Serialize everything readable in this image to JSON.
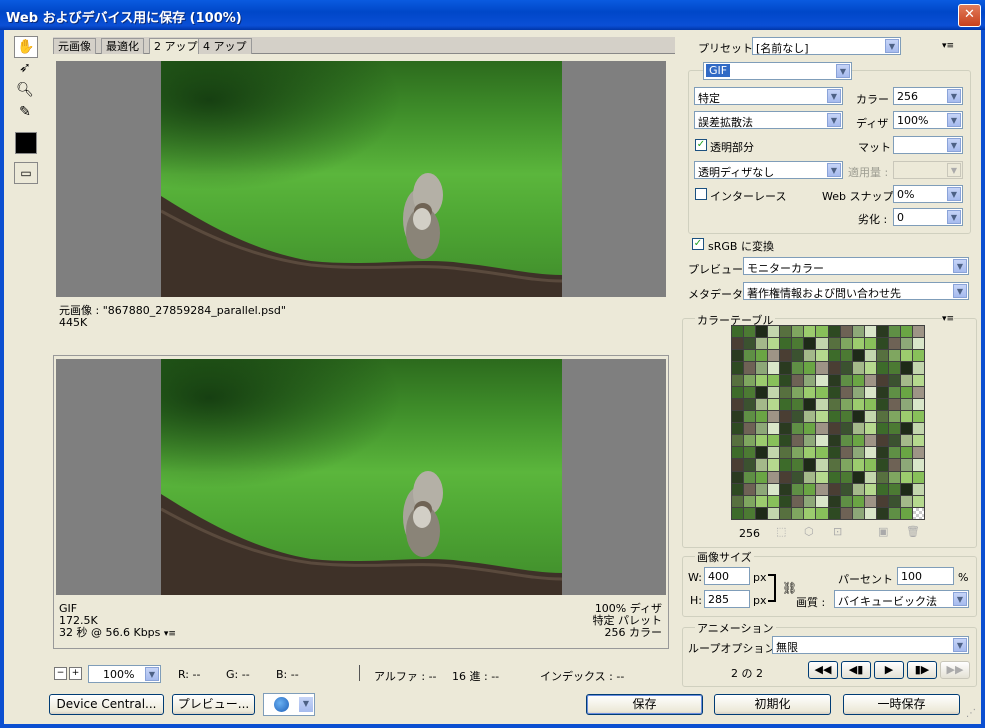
{
  "window": {
    "title": "Web およびデバイス用に保存 (100%)",
    "close": "✕"
  },
  "tabs": [
    {
      "label": "元画像",
      "active": false
    },
    {
      "label": "最適化",
      "active": false
    },
    {
      "label": "2 アップ",
      "active": true
    },
    {
      "label": "4 アップ",
      "active": false
    }
  ],
  "original_info": {
    "line1": "元画像 : \"867880_27859284_parallel.psd\"",
    "line2": "445K"
  },
  "optimized_info": {
    "format": "GIF",
    "size": "172.5K",
    "time": "32 秒 @ 56.6 Kbps",
    "dither": "100% ディザ",
    "palette": "特定 パレット",
    "colors": "256 カラー"
  },
  "bottom_bar": {
    "zoom": "100%",
    "r": "R: --",
    "g": "G: --",
    "b": "B: --",
    "alpha": "アルファ : --",
    "hex": "16 進 : --",
    "index": "インデックス : --"
  },
  "buttons": {
    "device_central": "Device Central...",
    "preview": "プレビュー...",
    "save": "保存",
    "reset": "初期化",
    "remember": "一時保存"
  },
  "settings": {
    "preset_label": "プリセット :",
    "preset_value": "[名前なし]",
    "format_value": "GIF",
    "reduction_value": "特定",
    "dither_algo_value": "誤差拡散法",
    "colors_label": "カラー :",
    "colors_value": "256",
    "dither_label": "ディザ :",
    "dither_value": "100%",
    "transparency_label": "透明部分",
    "transparency_checked": true,
    "matte_label": "マット :",
    "matte_value": "",
    "trans_dither_value": "透明ディザなし",
    "amount_label": "適用量 :",
    "amount_value": "",
    "interlaced_label": "インターレース",
    "interlaced_checked": false,
    "websnap_label": "Web スナップ :",
    "websnap_value": "0%",
    "lossy_label": "劣化 :",
    "lossy_value": "0",
    "srgb_label": "sRGB に変換",
    "srgb_checked": true,
    "preview_label": "プレビュー :",
    "preview_value": "モニターカラー",
    "metadata_label": "メタデータ :",
    "metadata_value": "著作権情報および問い合わせ先"
  },
  "color_table": {
    "title": "カラーテーブル",
    "count": "256"
  },
  "image_size": {
    "title": "画像サイズ",
    "w_label": "W:",
    "w_value": "400",
    "h_label": "H:",
    "h_value": "285",
    "unit": "px",
    "percent_label": "パーセント :",
    "percent_value": "100",
    "percent_unit": "%",
    "quality_label": "画質 :",
    "quality_value": "バイキュービック法"
  },
  "animation": {
    "title": "アニメーション",
    "loop_label": "ループオプション :",
    "loop_value": "無限",
    "frame_counter": "2 の 2"
  },
  "colors": {
    "titlebar": "#0a5be0",
    "accent": "#316ac5",
    "checkmark": "#21a121"
  }
}
